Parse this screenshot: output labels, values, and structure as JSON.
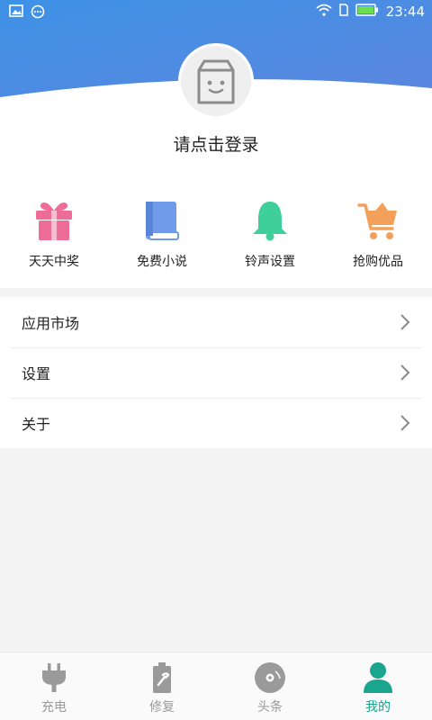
{
  "status_bar": {
    "time": "23:44"
  },
  "profile": {
    "login_prompt": "请点击登录"
  },
  "quick_actions": [
    {
      "label": "天天中奖",
      "icon": "gift-icon",
      "color": "#ee6d98"
    },
    {
      "label": "免费小说",
      "icon": "book-icon",
      "color": "#6f9bea"
    },
    {
      "label": "铃声设置",
      "icon": "bell-icon",
      "color": "#3ecf9c"
    },
    {
      "label": "抢购优品",
      "icon": "cart-icon",
      "color": "#f3a05a"
    }
  ],
  "menu": [
    {
      "label": "应用市场"
    },
    {
      "label": "设置"
    },
    {
      "label": "关于"
    }
  ],
  "tab_bar": [
    {
      "label": "充电",
      "icon": "plug-icon",
      "active": false
    },
    {
      "label": "修复",
      "icon": "battery-wrench-icon",
      "active": false
    },
    {
      "label": "头条",
      "icon": "disc-icon",
      "active": false
    },
    {
      "label": "我的",
      "icon": "user-icon",
      "active": true
    }
  ],
  "colors": {
    "header_gradient_start": "#3f8fe3",
    "header_gradient_end": "#5a8be0",
    "active_tab": "#1aa58f",
    "inactive_tab": "#9a9a9a"
  }
}
